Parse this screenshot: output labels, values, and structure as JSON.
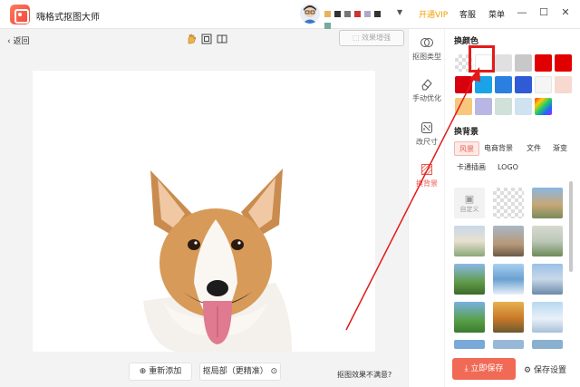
{
  "app": {
    "title": "嗨格式抠图大师"
  },
  "header": {
    "vip": "开通VIP",
    "service": "客服",
    "menu": "菜单"
  },
  "toolbar": {
    "back": "返回",
    "enhance": "效果增强"
  },
  "tools": [
    {
      "label": "抠图类型",
      "icon": "layers-icon"
    },
    {
      "label": "手动优化",
      "icon": "eraser-icon"
    },
    {
      "label": "改尺寸",
      "icon": "crop-icon"
    },
    {
      "label": "换背景",
      "icon": "background-icon"
    }
  ],
  "panel": {
    "color_title": "换颜色",
    "bg_title": "换背景",
    "colors": [
      "#ffffff",
      "#ffffff",
      "#e0e0e0",
      "#c8c8c8",
      "#e10000",
      "#e10000",
      "#d8000f",
      "#1aa3e8",
      "#2b7fe0",
      "#2f5bd6",
      "#f5f5f5",
      "#f7d9cf",
      "#f6c77d",
      "#b9b6e6",
      "#cfe1d8",
      "#cfe2f0",
      "gradient"
    ],
    "categories": [
      "风景",
      "电商背景",
      "文件",
      "渐变",
      "卡通插画",
      "LOGO"
    ],
    "custom_label": "自定义",
    "save": "立即保存",
    "save_settings": "保存设置"
  },
  "bottom": {
    "readd": "重新添加",
    "local": "抠局部（更精准）",
    "unsatisfied": "抠图效果不满意?"
  }
}
